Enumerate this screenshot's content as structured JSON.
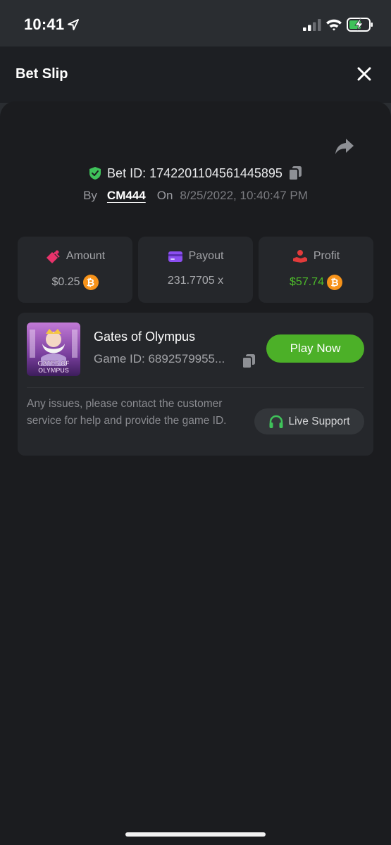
{
  "status_bar": {
    "time": "10:41"
  },
  "header": {
    "title": "Bet Slip"
  },
  "bet": {
    "bet_id_text": "Bet ID: 1742201104561445895",
    "by_label": "By",
    "username": "CM444",
    "on_label": "On",
    "date": "8/25/2022, 10:40:47 PM"
  },
  "stats": {
    "amount": {
      "label": "Amount",
      "value": "$0.25"
    },
    "payout": {
      "label": "Payout",
      "value": "231.7705 x"
    },
    "profit": {
      "label": "Profit",
      "value": "$57.74"
    },
    "currency_symbol": "₿"
  },
  "game": {
    "thumb_text_line1": "GATES OF",
    "thumb_text_line2": "OLYMPUS",
    "name": "Gates of Olympus",
    "id_text": "Game ID: 6892579955...",
    "play_label": "Play Now",
    "help_text": "Any issues, please contact the customer service for help and provide the game ID.",
    "support_label": "Live Support"
  },
  "colors": {
    "accent_green": "#4cb028",
    "profit_green": "#4dbb2a",
    "btc_orange": "#f7931a",
    "amount_icon": "#e8336b",
    "payout_icon": "#8b4ef0",
    "profit_icon": "#e23b3b"
  },
  "icons": [
    "location-arrow-icon",
    "signal-icon",
    "wifi-icon",
    "battery-charging-icon",
    "close-icon",
    "share-icon",
    "shield-check-icon",
    "copy-icon",
    "amount-icon",
    "payout-card-icon",
    "profit-hand-icon",
    "bitcoin-icon",
    "headset-icon"
  ]
}
